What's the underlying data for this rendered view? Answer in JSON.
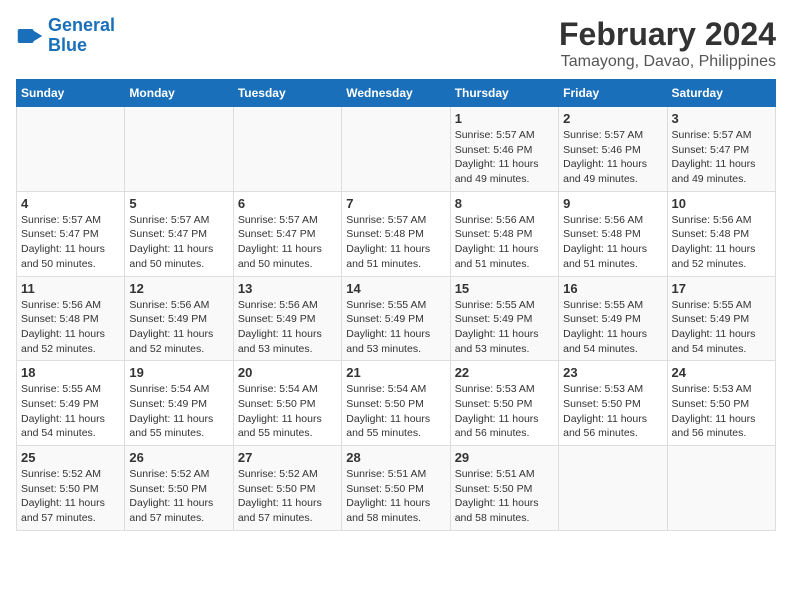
{
  "header": {
    "logo_line1": "General",
    "logo_line2": "Blue",
    "title": "February 2024",
    "subtitle": "Tamayong, Davao, Philippines"
  },
  "days_of_week": [
    "Sunday",
    "Monday",
    "Tuesday",
    "Wednesday",
    "Thursday",
    "Friday",
    "Saturday"
  ],
  "weeks": [
    [
      {
        "num": "",
        "info": ""
      },
      {
        "num": "",
        "info": ""
      },
      {
        "num": "",
        "info": ""
      },
      {
        "num": "",
        "info": ""
      },
      {
        "num": "1",
        "info": "Sunrise: 5:57 AM\nSunset: 5:46 PM\nDaylight: 11 hours\nand 49 minutes."
      },
      {
        "num": "2",
        "info": "Sunrise: 5:57 AM\nSunset: 5:46 PM\nDaylight: 11 hours\nand 49 minutes."
      },
      {
        "num": "3",
        "info": "Sunrise: 5:57 AM\nSunset: 5:47 PM\nDaylight: 11 hours\nand 49 minutes."
      }
    ],
    [
      {
        "num": "4",
        "info": "Sunrise: 5:57 AM\nSunset: 5:47 PM\nDaylight: 11 hours\nand 50 minutes."
      },
      {
        "num": "5",
        "info": "Sunrise: 5:57 AM\nSunset: 5:47 PM\nDaylight: 11 hours\nand 50 minutes."
      },
      {
        "num": "6",
        "info": "Sunrise: 5:57 AM\nSunset: 5:47 PM\nDaylight: 11 hours\nand 50 minutes."
      },
      {
        "num": "7",
        "info": "Sunrise: 5:57 AM\nSunset: 5:48 PM\nDaylight: 11 hours\nand 51 minutes."
      },
      {
        "num": "8",
        "info": "Sunrise: 5:56 AM\nSunset: 5:48 PM\nDaylight: 11 hours\nand 51 minutes."
      },
      {
        "num": "9",
        "info": "Sunrise: 5:56 AM\nSunset: 5:48 PM\nDaylight: 11 hours\nand 51 minutes."
      },
      {
        "num": "10",
        "info": "Sunrise: 5:56 AM\nSunset: 5:48 PM\nDaylight: 11 hours\nand 52 minutes."
      }
    ],
    [
      {
        "num": "11",
        "info": "Sunrise: 5:56 AM\nSunset: 5:48 PM\nDaylight: 11 hours\nand 52 minutes."
      },
      {
        "num": "12",
        "info": "Sunrise: 5:56 AM\nSunset: 5:49 PM\nDaylight: 11 hours\nand 52 minutes."
      },
      {
        "num": "13",
        "info": "Sunrise: 5:56 AM\nSunset: 5:49 PM\nDaylight: 11 hours\nand 53 minutes."
      },
      {
        "num": "14",
        "info": "Sunrise: 5:55 AM\nSunset: 5:49 PM\nDaylight: 11 hours\nand 53 minutes."
      },
      {
        "num": "15",
        "info": "Sunrise: 5:55 AM\nSunset: 5:49 PM\nDaylight: 11 hours\nand 53 minutes."
      },
      {
        "num": "16",
        "info": "Sunrise: 5:55 AM\nSunset: 5:49 PM\nDaylight: 11 hours\nand 54 minutes."
      },
      {
        "num": "17",
        "info": "Sunrise: 5:55 AM\nSunset: 5:49 PM\nDaylight: 11 hours\nand 54 minutes."
      }
    ],
    [
      {
        "num": "18",
        "info": "Sunrise: 5:55 AM\nSunset: 5:49 PM\nDaylight: 11 hours\nand 54 minutes."
      },
      {
        "num": "19",
        "info": "Sunrise: 5:54 AM\nSunset: 5:49 PM\nDaylight: 11 hours\nand 55 minutes."
      },
      {
        "num": "20",
        "info": "Sunrise: 5:54 AM\nSunset: 5:50 PM\nDaylight: 11 hours\nand 55 minutes."
      },
      {
        "num": "21",
        "info": "Sunrise: 5:54 AM\nSunset: 5:50 PM\nDaylight: 11 hours\nand 55 minutes."
      },
      {
        "num": "22",
        "info": "Sunrise: 5:53 AM\nSunset: 5:50 PM\nDaylight: 11 hours\nand 56 minutes."
      },
      {
        "num": "23",
        "info": "Sunrise: 5:53 AM\nSunset: 5:50 PM\nDaylight: 11 hours\nand 56 minutes."
      },
      {
        "num": "24",
        "info": "Sunrise: 5:53 AM\nSunset: 5:50 PM\nDaylight: 11 hours\nand 56 minutes."
      }
    ],
    [
      {
        "num": "25",
        "info": "Sunrise: 5:52 AM\nSunset: 5:50 PM\nDaylight: 11 hours\nand 57 minutes."
      },
      {
        "num": "26",
        "info": "Sunrise: 5:52 AM\nSunset: 5:50 PM\nDaylight: 11 hours\nand 57 minutes."
      },
      {
        "num": "27",
        "info": "Sunrise: 5:52 AM\nSunset: 5:50 PM\nDaylight: 11 hours\nand 57 minutes."
      },
      {
        "num": "28",
        "info": "Sunrise: 5:51 AM\nSunset: 5:50 PM\nDaylight: 11 hours\nand 58 minutes."
      },
      {
        "num": "29",
        "info": "Sunrise: 5:51 AM\nSunset: 5:50 PM\nDaylight: 11 hours\nand 58 minutes."
      },
      {
        "num": "",
        "info": ""
      },
      {
        "num": "",
        "info": ""
      }
    ]
  ]
}
